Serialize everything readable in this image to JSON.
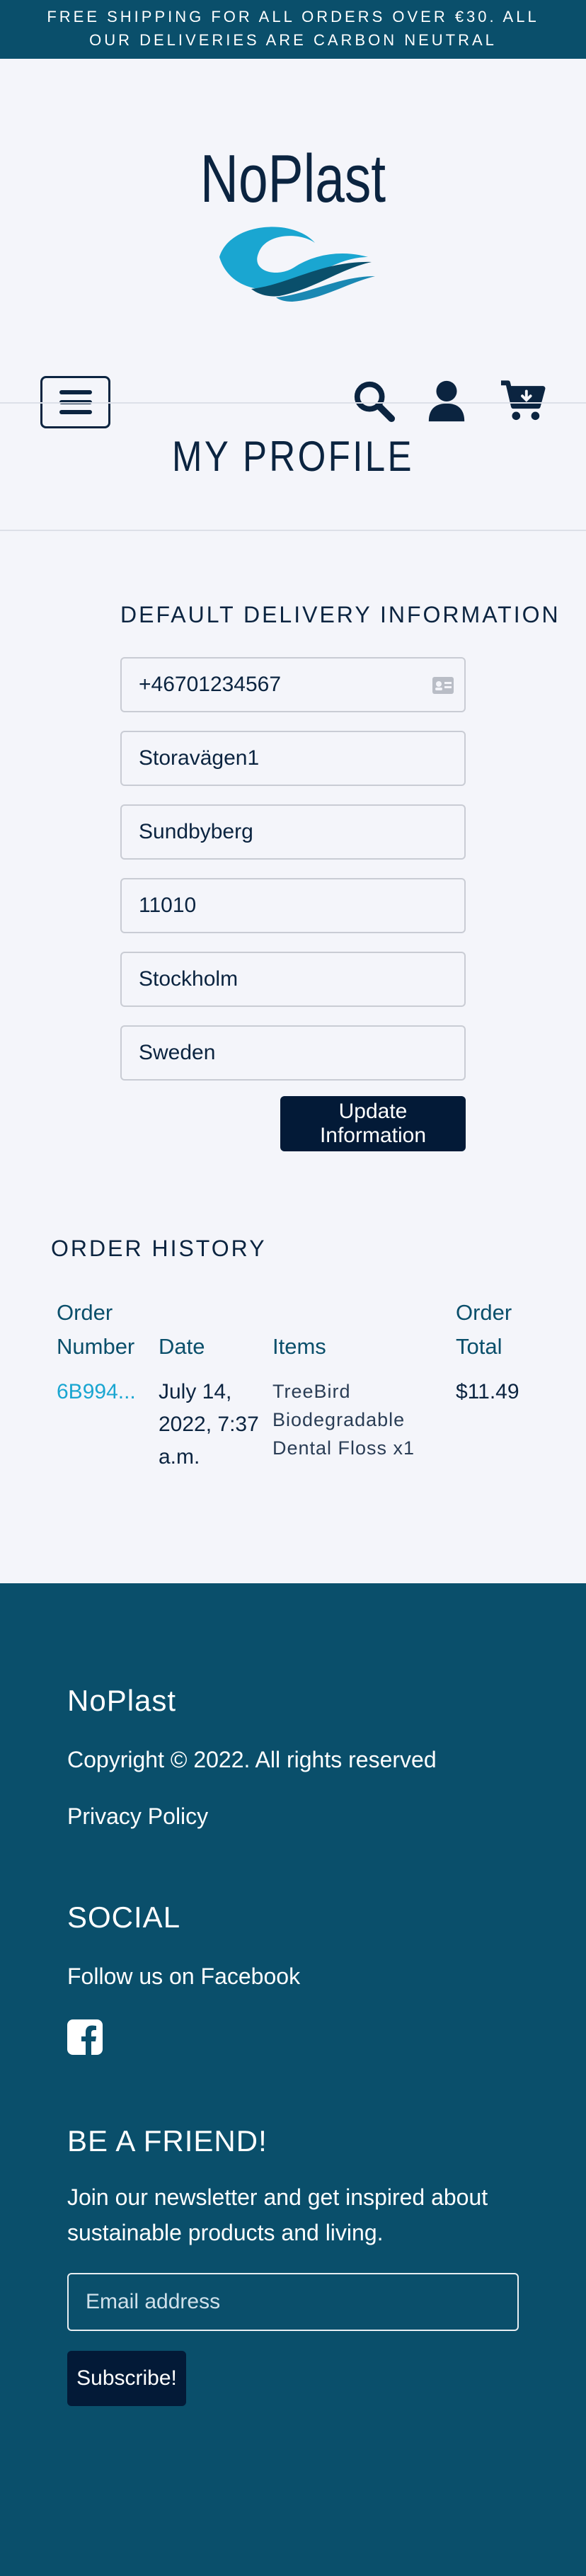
{
  "banner": {
    "text": "FREE SHIPPING FOR ALL ORDERS OVER €30. ALL OUR DELIVERIES ARE CARBON NEUTRAL"
  },
  "header": {
    "logo_text": "NoPlast",
    "icons": {
      "menu": "hamburger-menu-icon",
      "search": "search-icon",
      "account": "user-icon",
      "cart": "cart-icon"
    }
  },
  "page": {
    "title": "MY PROFILE"
  },
  "delivery": {
    "title": "DEFAULT DELIVERY INFORMATION",
    "phone": "+46701234567",
    "street": "Storavägen1",
    "town": "Sundbyberg",
    "postcode": "11010",
    "county": "Stockholm",
    "country": "Sweden",
    "update_label": "Update Information"
  },
  "order_history": {
    "title": "ORDER HISTORY",
    "headers": {
      "number_1": "Order",
      "number_2": "Number",
      "date": "Date",
      "items": "Items",
      "total_1": "Order",
      "total_2": "Total"
    },
    "rows": [
      {
        "number": "6B994...",
        "date_1": "July 14,",
        "date_2": "2022, 7:37",
        "date_3": "a.m.",
        "items_1": "TreeBird",
        "items_2": "Biodegradable",
        "items_3": "Dental Floss x1",
        "total": "$11.49"
      }
    ]
  },
  "footer": {
    "brand": "NoPlast",
    "copyright": "Copyright © 2022. All rights reserved",
    "privacy": "Privacy Policy",
    "social_title": "SOCIAL",
    "facebook_text": "Follow us on Facebook",
    "friend_title": "BE A FRIEND!",
    "newsletter_1": "Join our newsletter and get inspired about",
    "newsletter_2": "sustainable products and living.",
    "email_placeholder": "Email address",
    "subscribe_label": "Subscribe!"
  },
  "colors": {
    "banner": "#0a4f6b",
    "footer": "#0a4f6b",
    "primary_button": "#031a37",
    "link": "#1aa6d1",
    "text": "#0b2440"
  }
}
